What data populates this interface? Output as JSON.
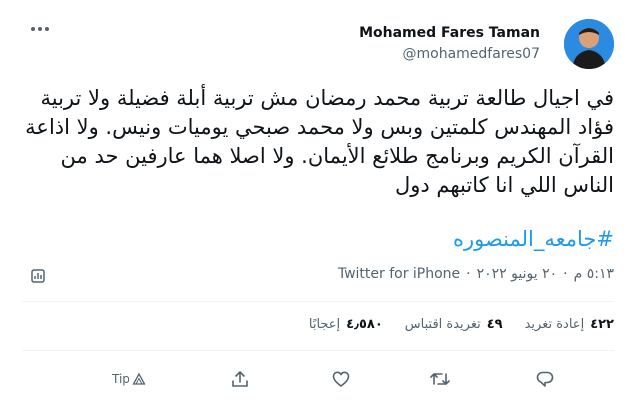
{
  "author": {
    "name": "Mohamed Fares Taman",
    "handle": "@mohamedfares07"
  },
  "tweet": {
    "text": "في اجيال طالعة تربية محمد رمضان مش تربية أبلة فضيلة ولا تربية فؤاد المهندس كلمتين وبس ولا محمد صبحي يوميات ونيس. ولا اذاعة القرآن الكريم وبرنامج طلائع الأيمان. ولا اصلا هما عارفين حد من الناس اللي انا كاتبهم دول",
    "hashtag": "#جامعه_المنصوره"
  },
  "meta": {
    "time": "٥:١٣ م",
    "date": "٢٠ يونيو ٢٠٢٢",
    "separator": "·",
    "source": "Twitter for iPhone"
  },
  "stats": {
    "retweets": {
      "count": "٤٢٢",
      "label": "إعادة تغريد"
    },
    "quotes": {
      "count": "٤٩",
      "label": "تغريدة اقتباس"
    },
    "likes": {
      "count": "٤٫٥٨٠",
      "label": "إعجابًا"
    }
  },
  "actions": {
    "tip_label": "Tip"
  },
  "icons": [
    "more-icon",
    "analytics-icon",
    "reply-icon",
    "retweet-icon",
    "like-icon",
    "share-icon",
    "tip-icon"
  ],
  "colors": {
    "accent": "#1d9bf0",
    "text": "#0f1419",
    "secondary": "#536471",
    "divider": "#eff3f4"
  }
}
